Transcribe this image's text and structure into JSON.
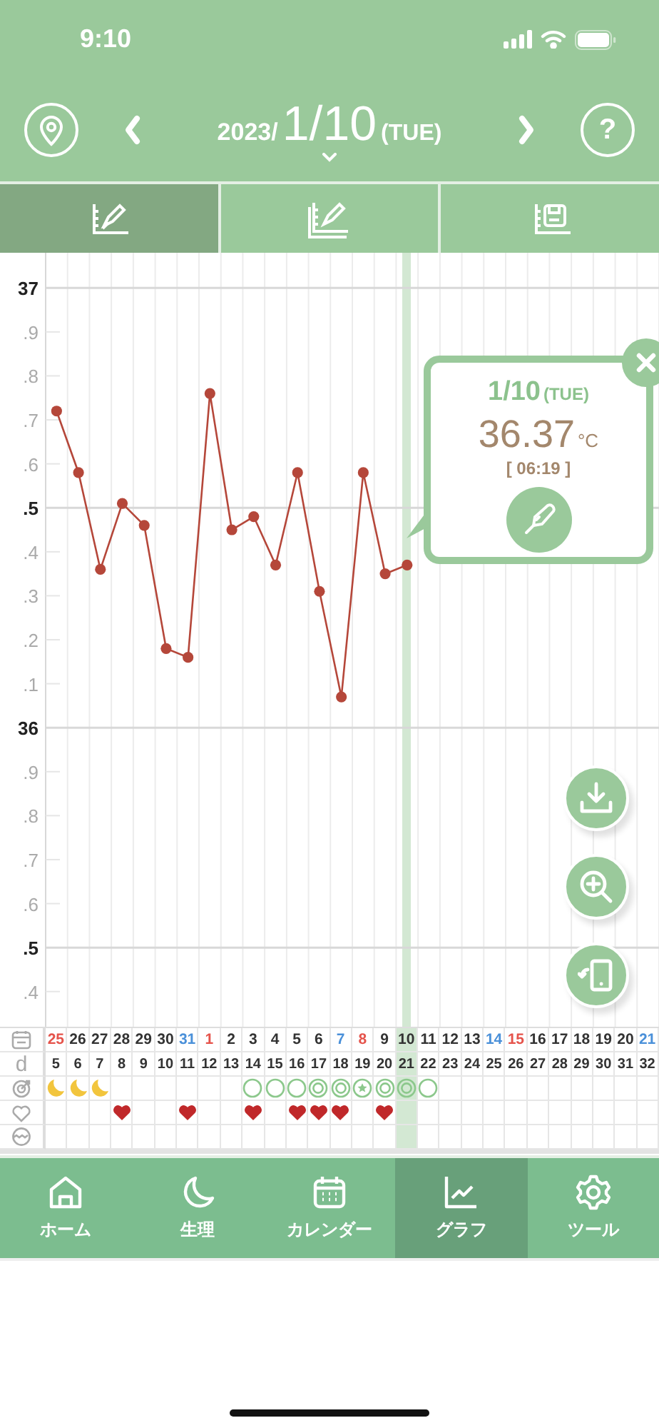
{
  "status_bar": {
    "time": "9:10"
  },
  "header": {
    "year": "2023/",
    "date": "1/10",
    "weekday": "(TUE)",
    "help_label": "?"
  },
  "view_tabs": [
    {
      "kind": "record",
      "selected": true
    },
    {
      "kind": "compare",
      "selected": false
    },
    {
      "kind": "save",
      "selected": false
    }
  ],
  "chart": {
    "y_axis_labels": [
      "37",
      ".9",
      ".8",
      ".7",
      ".6",
      ".5",
      ".4",
      ".3",
      ".2",
      ".1",
      "36",
      ".9",
      ".8",
      ".7",
      ".6",
      ".5",
      ".4"
    ],
    "chart_data": {
      "type": "line",
      "grid": true,
      "ylim": [
        35.32,
        37.08
      ],
      "yticks": [
        37,
        36
      ],
      "series": [
        {
          "color": "#b5473a",
          "marker": "o",
          "values": [
            36.72,
            36.58,
            36.36,
            36.51,
            36.46,
            36.18,
            36.16,
            36.76,
            36.45,
            36.48,
            36.37,
            36.58,
            36.31,
            36.07,
            36.58,
            36.35,
            36.37,
            null,
            null,
            null,
            null,
            null,
            null,
            null,
            null,
            null,
            null,
            null
          ]
        }
      ]
    }
  },
  "popup": {
    "date": "1/10",
    "weekday": "(TUE)",
    "temperature": "36.37",
    "unit": "°C",
    "time": "[ 06:19 ]"
  },
  "day_row_label": "d",
  "days": [
    {
      "date": "25",
      "color": "#e5534b",
      "cycle_day": "5",
      "kind": "moon",
      "heart": false,
      "selected": false
    },
    {
      "date": "26",
      "color": "#333333",
      "cycle_day": "6",
      "kind": "moon",
      "heart": false,
      "selected": false
    },
    {
      "date": "27",
      "color": "#333333",
      "cycle_day": "7",
      "kind": "moon",
      "heart": false,
      "selected": false
    },
    {
      "date": "28",
      "color": "#333333",
      "cycle_day": "8",
      "heart": true,
      "selected": false
    },
    {
      "date": "29",
      "color": "#333333",
      "cycle_day": "9",
      "heart": false,
      "selected": false
    },
    {
      "date": "30",
      "color": "#333333",
      "cycle_day": "10",
      "heart": false,
      "selected": false
    },
    {
      "date": "31",
      "color": "#4a90d9",
      "cycle_day": "11",
      "heart": true,
      "selected": false
    },
    {
      "date": "1",
      "color": "#e5534b",
      "cycle_day": "12",
      "heart": false,
      "selected": false
    },
    {
      "date": "2",
      "color": "#333333",
      "cycle_day": "13",
      "heart": false,
      "selected": false
    },
    {
      "date": "3",
      "color": "#333333",
      "cycle_day": "14",
      "kind": "ring",
      "heart": true,
      "selected": false
    },
    {
      "date": "4",
      "color": "#333333",
      "cycle_day": "15",
      "kind": "ring",
      "heart": false,
      "selected": false
    },
    {
      "date": "5",
      "color": "#333333",
      "cycle_day": "16",
      "kind": "ring",
      "heart": true,
      "selected": false
    },
    {
      "date": "6",
      "color": "#333333",
      "cycle_day": "17",
      "kind": "double-ring",
      "heart": true,
      "selected": false
    },
    {
      "date": "7",
      "color": "#4a90d9",
      "cycle_day": "18",
      "kind": "double-ring",
      "heart": true,
      "selected": false
    },
    {
      "date": "8",
      "color": "#e5534b",
      "cycle_day": "19",
      "kind": "star-ring",
      "heart": false,
      "selected": false
    },
    {
      "date": "9",
      "color": "#333333",
      "cycle_day": "20",
      "kind": "double-ring",
      "heart": true,
      "selected": false
    },
    {
      "date": "10",
      "color": "#333333",
      "cycle_day": "21",
      "kind": "double-ring",
      "heart": false,
      "selected": true
    },
    {
      "date": "11",
      "color": "#333333",
      "cycle_day": "22",
      "kind": "ring",
      "heart": false,
      "selected": false
    },
    {
      "date": "12",
      "color": "#333333",
      "cycle_day": "23",
      "heart": false,
      "selected": false
    },
    {
      "date": "13",
      "color": "#333333",
      "cycle_day": "24",
      "heart": false,
      "selected": false
    },
    {
      "date": "14",
      "color": "#4a90d9",
      "cycle_day": "25",
      "heart": false,
      "selected": false
    },
    {
      "date": "15",
      "color": "#e5534b",
      "cycle_day": "26",
      "heart": false,
      "selected": false
    },
    {
      "date": "16",
      "color": "#333333",
      "cycle_day": "27",
      "heart": false,
      "selected": false
    },
    {
      "date": "17",
      "color": "#333333",
      "cycle_day": "28",
      "heart": false,
      "selected": false
    },
    {
      "date": "18",
      "color": "#333333",
      "cycle_day": "29",
      "heart": false,
      "selected": false
    },
    {
      "date": "19",
      "color": "#333333",
      "cycle_day": "30",
      "heart": false,
      "selected": false
    },
    {
      "date": "20",
      "color": "#333333",
      "cycle_day": "31",
      "heart": false,
      "selected": false
    },
    {
      "date": "21",
      "color": "#4a90d9",
      "cycle_day": "32",
      "heart": false,
      "selected": false
    }
  ],
  "bottom_nav": [
    {
      "kind": "home",
      "label": "ホーム",
      "selected": false
    },
    {
      "kind": "moon",
      "label": "生理",
      "selected": false
    },
    {
      "kind": "calendar",
      "label": "カレンダー",
      "selected": false
    },
    {
      "kind": "graph",
      "label": "グラフ",
      "selected": true
    },
    {
      "kind": "gear",
      "label": "ツール",
      "selected": false
    }
  ]
}
